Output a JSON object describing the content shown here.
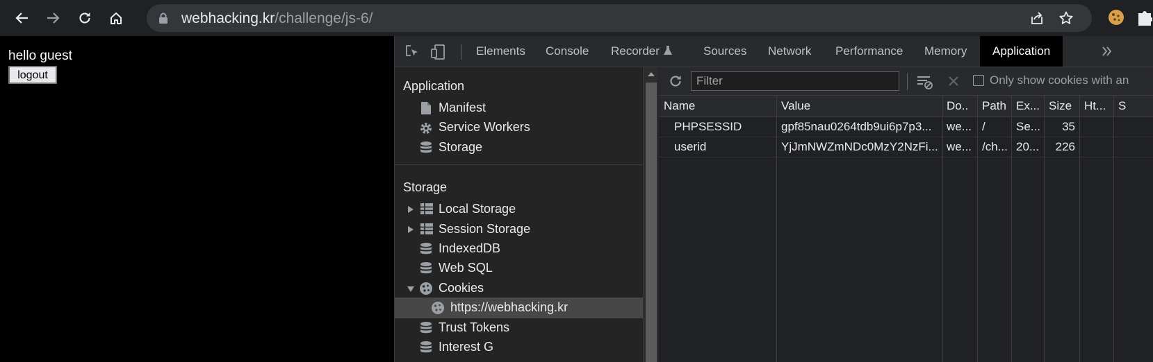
{
  "browser": {
    "url_host": "webhacking.kr",
    "url_path": "/challenge/js-6/"
  },
  "page": {
    "greeting": "hello guest",
    "logout_label": "logout"
  },
  "devtools": {
    "tabs": [
      "Elements",
      "Console",
      "Recorder",
      "Sources",
      "Network",
      "Performance",
      "Memory",
      "Application"
    ],
    "active_tab": "Application",
    "sidebar": {
      "application_heading": "Application",
      "application_items": [
        {
          "label": "Manifest",
          "icon": "file-icon"
        },
        {
          "label": "Service Workers",
          "icon": "gear-icon"
        },
        {
          "label": "Storage",
          "icon": "database-icon"
        }
      ],
      "storage_heading": "Storage",
      "storage_items": [
        {
          "label": "Local Storage",
          "icon": "grid-icon",
          "expander": "collapsed"
        },
        {
          "label": "Session Storage",
          "icon": "grid-icon",
          "expander": "collapsed"
        },
        {
          "label": "IndexedDB",
          "icon": "database-icon"
        },
        {
          "label": "Web SQL",
          "icon": "database-icon"
        },
        {
          "label": "Cookies",
          "icon": "cookie-icon",
          "expander": "expanded"
        },
        {
          "label": "https://webhacking.kr",
          "icon": "cookie-icon",
          "selected": true
        },
        {
          "label": "Trust Tokens",
          "icon": "database-icon"
        },
        {
          "label": "Interest G",
          "icon": "database-icon"
        }
      ]
    },
    "cookies": {
      "filter_placeholder": "Filter",
      "only_show_label": "Only show cookies with an",
      "columns": [
        "Name",
        "Value",
        "Do..",
        "Path",
        "Ex...",
        "Size",
        "Ht...",
        "S"
      ],
      "rows": [
        {
          "name": "PHPSESSID",
          "value": "gpf85nau0264tdb9ui6p7p3...",
          "domain": "we...",
          "path": "/",
          "expires": "Se...",
          "size": "35"
        },
        {
          "name": "userid",
          "value": "YjJmNWZmNDc0MzY2NzFi...",
          "domain": "we...",
          "path": "/ch...",
          "expires": "20...",
          "size": "226"
        }
      ]
    }
  },
  "colors": {
    "toolbar_bg": "#202124",
    "omnibox_bg": "#35363a",
    "devtools_bg": "#242424",
    "active_tab_bg": "#000000",
    "selected_item_bg": "#474747"
  }
}
